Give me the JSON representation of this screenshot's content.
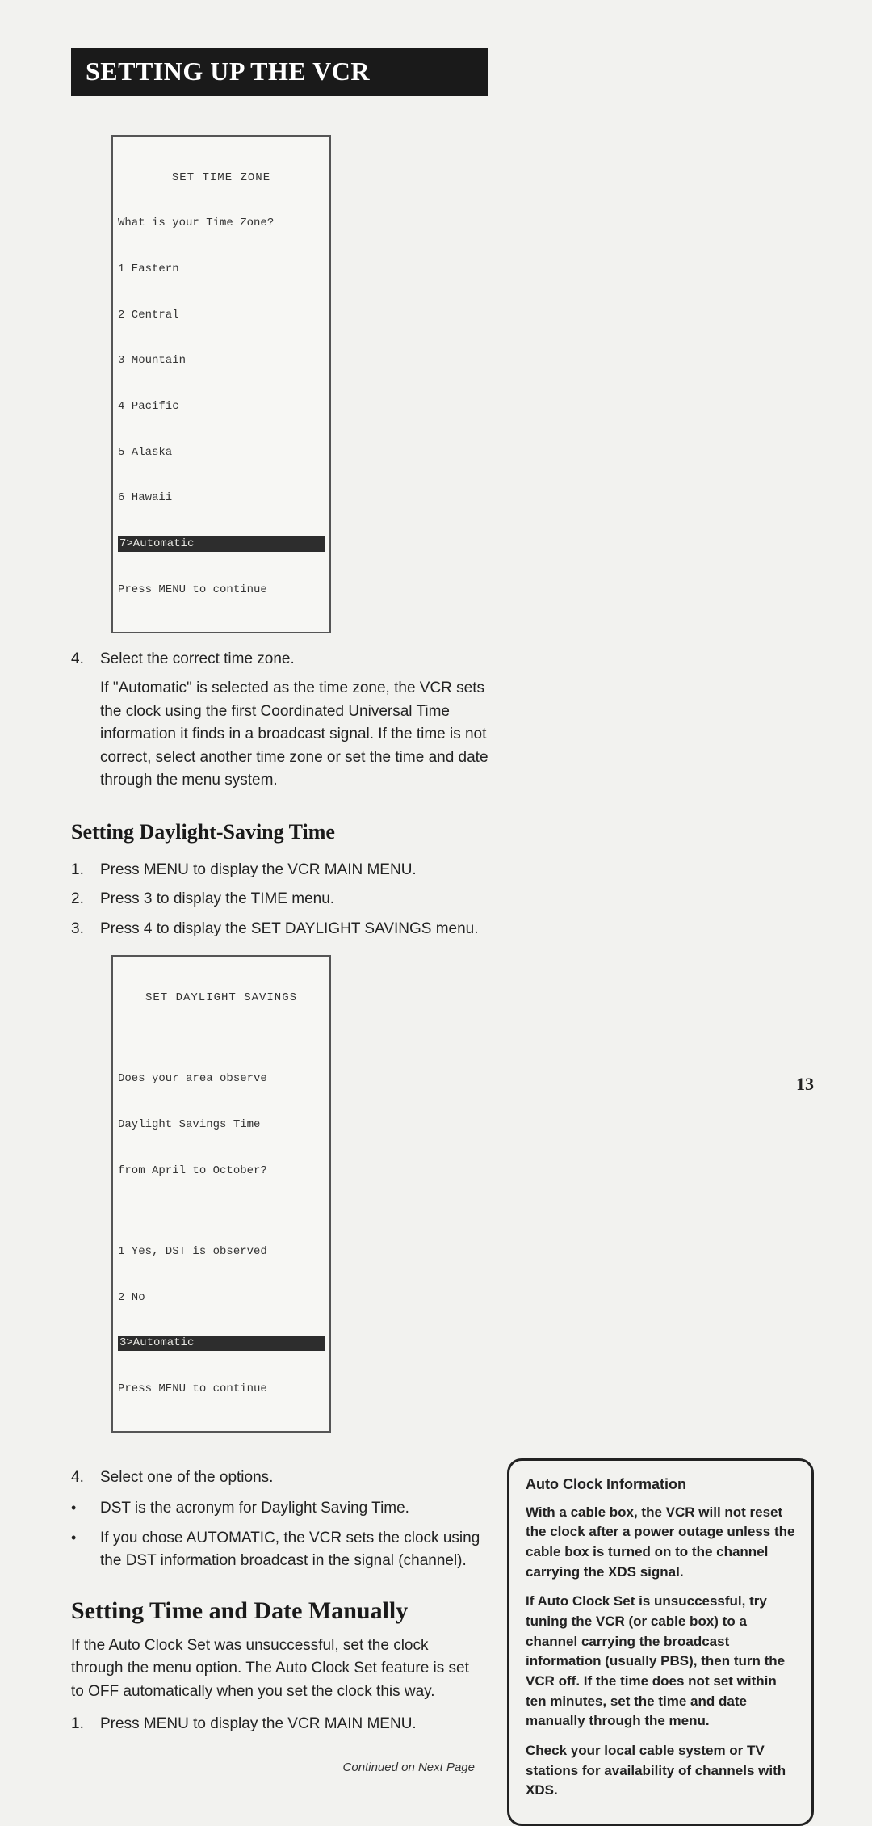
{
  "banner": "SETTING UP THE VCR",
  "screen1": {
    "title": "SET TIME ZONE",
    "prompt": "What is your Time Zone?",
    "opts": [
      "1 Eastern",
      "2 Central",
      "3 Mountain",
      "4 Pacific",
      "5 Alaska",
      "6 Hawaii"
    ],
    "hl": "7>Automatic",
    "footer": "Press MENU to continue"
  },
  "step4a": "Select the correct time zone.",
  "para1": "If \"Automatic\" is selected as the time zone, the VCR sets the clock using the first Coordinated Universal Time information it finds in a broadcast signal. If the time is not correct, select another time zone or set the time and date through the menu system.",
  "h2a": "Setting Daylight-Saving Time",
  "dst_steps": [
    "Press MENU to display the VCR MAIN MENU.",
    "Press 3 to display the TIME menu.",
    "Press 4 to display the SET DAYLIGHT SAVINGS menu."
  ],
  "screen2": {
    "title": "SET DAYLIGHT SAVINGS",
    "q1": "Does your area observe",
    "q2": "Daylight Savings Time",
    "q3": "from April to October?",
    "opts": [
      "1 Yes, DST is observed",
      "2 No"
    ],
    "hl": "3>Automatic",
    "footer": "Press MENU to continue"
  },
  "step4b": "Select one of the options.",
  "bullets": [
    "DST is the acronym for Daylight Saving Time.",
    "If you chose AUTOMATIC, the VCR sets the clock using the DST information broadcast in the signal (channel)."
  ],
  "h2b": "Setting Time and Date Manually",
  "para2": "If the Auto Clock Set was unsuccessful, set the clock through the menu option. The Auto Clock Set feature is set to OFF automatically when you set the clock this way.",
  "step1c": "Press MENU to display the VCR MAIN MENU.",
  "continued": "Continued on Next Page",
  "sidebox": {
    "title": "Auto Clock Information",
    "p1": "With a cable box, the VCR will not reset the clock after a power outage unless the cable box is turned on to the channel carrying the XDS signal.",
    "p2": "If Auto Clock Set is unsuccessful, try tuning the VCR (or cable box) to a channel carrying the broadcast information (usually PBS), then turn the VCR off. If the time does not set within ten minutes, set the time and date manually through the menu.",
    "p3": "Check your local cable system or TV stations for availability of channels with XDS."
  },
  "pagenum": "13"
}
